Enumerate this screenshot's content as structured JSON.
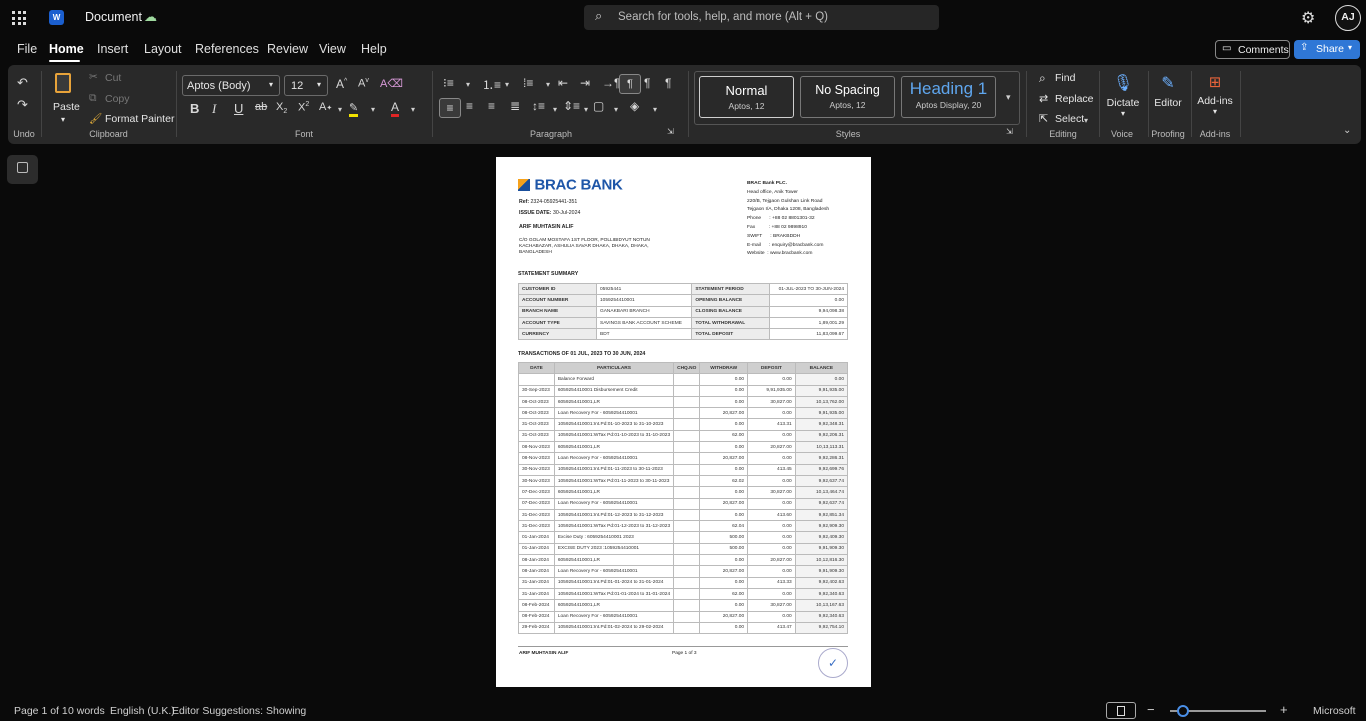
{
  "app": {
    "doc_title": "Document",
    "search_placeholder": "Search for tools, help, and more (Alt + Q)",
    "avatar": "AJ"
  },
  "menu": [
    "File",
    "Home",
    "Insert",
    "Layout",
    "References",
    "Review",
    "View",
    "Help"
  ],
  "actions": {
    "comments": "Comments",
    "share": "Share"
  },
  "ribbon": {
    "clipboard": {
      "paste": "Paste",
      "cut": "Cut",
      "copy": "Copy",
      "format_painter": "Format Painter",
      "label": "Clipboard"
    },
    "undo_label": "Undo",
    "font": {
      "family": "Aptos (Body)",
      "size": "12",
      "label": "Font"
    },
    "paragraph_label": "Paragraph",
    "styles": {
      "items": [
        {
          "name": "Normal",
          "sub": "Aptos, 12"
        },
        {
          "name": "No Spacing",
          "sub": "Aptos, 12"
        },
        {
          "name": "Heading 1",
          "sub": "Aptos Display, 20"
        }
      ],
      "label": "Styles"
    },
    "editing": {
      "find": "Find",
      "replace": "Replace",
      "select": "Select",
      "label": "Editing"
    },
    "voice": {
      "dictate": "Dictate",
      "label": "Voice"
    },
    "proofing": {
      "editor": "Editor",
      "label": "Proofing"
    },
    "addins": {
      "btn": "Add-ins",
      "label": "Add-ins"
    },
    "accent_color": "#0f6cbd"
  },
  "statement": {
    "bank_logo": "BRAC BANK",
    "ref_label": "Ref:",
    "ref": "2324-05925441-351",
    "issue_label": "ISSUE DATE:",
    "issue_date": "30-Jul-2024",
    "customer_name": "ARIF MUHTASIN ALIF",
    "address": [
      "C/O GOLAM MOSTAFA 1ST FLOOR, POLLIBIDYUT NOTUN",
      "KACHABAZAR, ASHULIA SAVAR DHAKA, DHAKA, DHAKA,",
      "BANGLADESH"
    ],
    "bank_lines": [
      "BRAC Bank PLC.",
      "Head office, Anik Tower",
      "220/B, Tejgaon Gulshan Link Road",
      "Tejgaon I/A, Dhaka 1208, Bangladesh",
      "Phone      : +88 02 8801301-32",
      "Fax          : +88 02 9898910",
      "SWIFT      : BRAKBDDH",
      "E-mail      : enquiry@bracbank.com",
      "Website  : www.bracbank.com"
    ],
    "summary_title": "STATEMENT SUMMARY",
    "summary": [
      [
        "CUSTOMER ID",
        "05925441",
        "STATEMENT PERIOD",
        "01-JUL-2023 TO 30-JUN-2024"
      ],
      [
        "ACCOUNT NUMBER",
        "1059254410001",
        "OPENING BALANCE",
        "0.00"
      ],
      [
        "BRANCH NAME",
        "GANAKBARI BRANCH",
        "CLOSING BALANCE",
        "9,94,098.38"
      ],
      [
        "ACCOUNT TYPE",
        "SAVINGS BANK ACCOUNT SCHEME",
        "TOTAL WITHDRAWAL",
        "1,89,001.29"
      ],
      [
        "CURRENCY",
        "BDT",
        "TOTAL DEPOSIT",
        "11,83,099.67"
      ]
    ],
    "txn_title": "TRANSACTIONS OF 01 JUL, 2023 TO 30 JUN, 2024",
    "txn_headers": [
      "DATE",
      "PARTICULARS",
      "CHQ.NO",
      "WITHDRAW",
      "DEPOSIT",
      "BALANCE"
    ],
    "txns": [
      [
        "",
        "Balance Forward",
        "",
        "0.00",
        "0.00",
        "0.00"
      ],
      [
        "30-Sep-2023",
        "6059254410001 Disbursement Credit",
        "",
        "0.00",
        "9,91,935.00",
        "9,91,935.00"
      ],
      [
        "08-Oct-2023",
        "6059254410001,LR",
        "",
        "0.00",
        "30,827.00",
        "10,13,762.00"
      ],
      [
        "08-Oct-2023",
        "Loan Recovery For - 6059254410001",
        "",
        "20,827.00",
        "0.00",
        "9,91,935.00"
      ],
      [
        "31-Oct-2023",
        "1059254410001:Int.Pd:01-10-2023 to 31-10-2023",
        "",
        "0.00",
        "413.31",
        "9,92,348.31"
      ],
      [
        "31-Oct-2023",
        "1059254410001:WTax Pd:01-10-2023 to 31-10-2023",
        "",
        "62.00",
        "0.00",
        "9,92,206.31"
      ],
      [
        "08-Nov-2023",
        "6059254410001,LR",
        "",
        "0.00",
        "20,827.00",
        "10,13,113.31"
      ],
      [
        "08-Nov-2023",
        "Loan Recovery For - 6059254410001",
        "",
        "20,827.00",
        "0.00",
        "9,92,286.31"
      ],
      [
        "30-Nov-2023",
        "1059254410001:Int.Pd:01-11-2023 to 30-11-2023",
        "",
        "0.00",
        "413.45",
        "9,92,699.76"
      ],
      [
        "30-Nov-2023",
        "1059254410001:WTax Pd:01-11-2023 to 30-11-2023",
        "",
        "62.02",
        "0.00",
        "9,92,637.74"
      ],
      [
        "07-Dec-2023",
        "6059254410001,LR",
        "",
        "0.00",
        "30,827.00",
        "10,13,464.74"
      ],
      [
        "07-Dec-2023",
        "Loan Recovery For - 6059254410001",
        "",
        "20,827.00",
        "0.00",
        "9,92,637.74"
      ],
      [
        "31-Dec-2023",
        "1059254410001:Int.Pd:01-12-2023 to 31-12-2023",
        "",
        "0.00",
        "413.60",
        "9,92,851.34"
      ],
      [
        "31-Dec-2023",
        "1059254410001:WTax Pd:01-12-2023 to 31-12-2023",
        "",
        "62.04",
        "0.00",
        "9,92,909.30"
      ],
      [
        "01-Jan-2024",
        "Excise Duty : 6059254410001  2023",
        "",
        "500.00",
        "0.00",
        "9,92,409.30"
      ],
      [
        "01-Jan-2024",
        "EXCISE DUTY 2023 :1059254410001",
        "",
        "500.00",
        "0.00",
        "9,91,909.30"
      ],
      [
        "08-Jan-2024",
        "6059254410001,LR",
        "",
        "0.00",
        "20,827.00",
        "10,12,816.30"
      ],
      [
        "08-Jan-2024",
        "Loan Recovery For - 6059254410001",
        "",
        "20,827.00",
        "0.00",
        "9,91,909.30"
      ],
      [
        "31-Jan-2024",
        "1059254410001:Int.Pd:01-01-2024 to 31-01-2024",
        "",
        "0.00",
        "413.33",
        "9,92,402.63"
      ],
      [
        "31-Jan-2024",
        "1059254410001:WTax Pd:01-01-2024 to 31-01-2024",
        "",
        "62.00",
        "0.00",
        "9,92,340.63"
      ],
      [
        "08-Feb-2024",
        "6059254410001,LR",
        "",
        "0.00",
        "30,827.00",
        "10,13,167.63"
      ],
      [
        "08-Feb-2024",
        "Loan Recovery For - 6059254410001",
        "",
        "20,827.00",
        "0.00",
        "9,92,340.63"
      ],
      [
        "29-Feb-2024",
        "1059254410001:Int.Pd:01-02-2024 to 29-02-2024",
        "",
        "0.00",
        "413.47",
        "9,92,754.10"
      ]
    ],
    "footer_name": "ARIF MUHTASIN ALIF",
    "footer_page": "Page 1 of 3"
  },
  "status": {
    "page": "Page 1 of 1",
    "words": "0 words",
    "lang": "English (U.K.)",
    "editor": "Editor Suggestions: Showing",
    "zoom_label": "Microsoft",
    "zoom_level": 0.07
  }
}
